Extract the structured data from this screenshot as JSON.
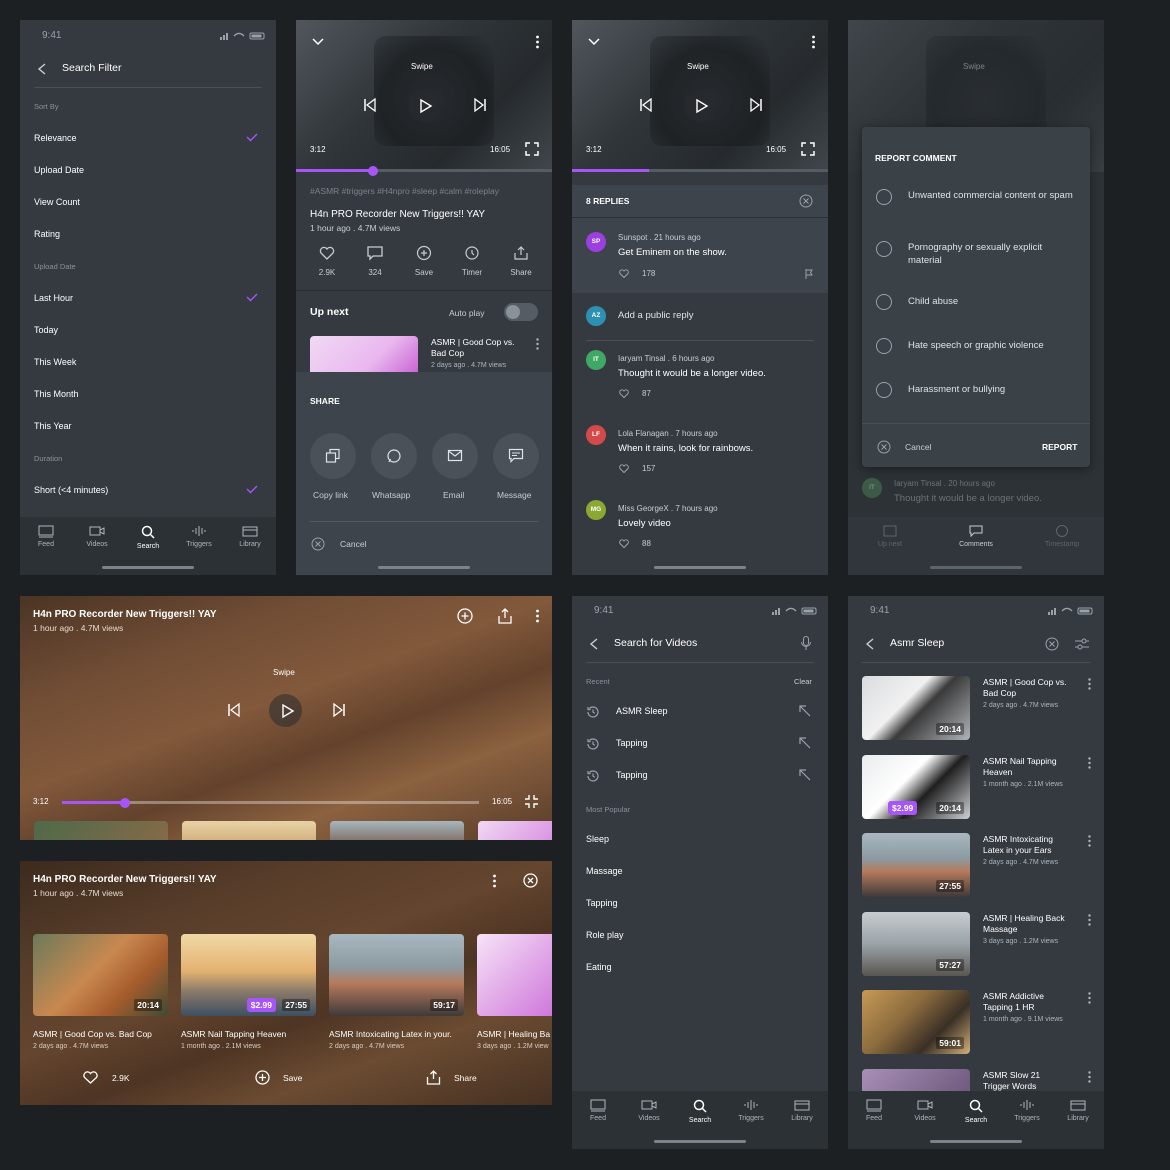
{
  "status_time": "9:41",
  "filter": {
    "title": "Search Filter",
    "sort_by": "Sort By",
    "sort_items": [
      "Relevance",
      "Upload Date",
      "View Count",
      "Rating"
    ],
    "upload_date": "Upload Date",
    "date_items": [
      "Last Hour",
      "Today",
      "This Week",
      "This Month",
      "This Year"
    ],
    "duration": "Duration",
    "duration_items": [
      "Short (<4 minutes)"
    ]
  },
  "nav": {
    "feed": "Feed",
    "videos": "Videos",
    "search": "Search",
    "triggers": "Triggers",
    "library": "Library"
  },
  "player": {
    "swipe": "Swipe",
    "elapsed": "3:12",
    "total": "16:05",
    "progress": 0.3,
    "tags": "#ASMR #triggers #H4npro #sleep #calm #roleplay",
    "title": "H4n PRO Recorder New Triggers!! YAY",
    "meta": "1 hour ago . 4.7M views",
    "likes": "2.9K",
    "comments": "324",
    "save": "Save",
    "timer": "Timer",
    "share": "Share",
    "up_next": "Up next",
    "autoplay": "Auto play",
    "next_title_1": "ASMR | Good Cop vs.",
    "next_title_2": "Bad Cop",
    "next_meta": "2 days ago . 4.7M views"
  },
  "share_sheet": {
    "heading": "SHARE",
    "options": [
      "Copy link",
      "Whatsapp",
      "Email",
      "Message"
    ],
    "cancel": "Cancel"
  },
  "replies": {
    "heading": "8 REPLIES",
    "top": {
      "initials": "SP",
      "meta": "Sunspot . 21 hours ago",
      "text": "Get Eminem on the show.",
      "likes": "178"
    },
    "add_reply": {
      "initials": "AZ",
      "placeholder": "Add a public reply"
    },
    "items": [
      {
        "initials": "IT",
        "meta": "Iaryam Tinsal . 6 hours ago",
        "text": "Thought it would be a longer video.",
        "likes": "87",
        "color": "#3fa865"
      },
      {
        "initials": "LF",
        "meta": "Lola Flanagan . 7 hours ago",
        "text": "When it rains, look for rainbows.",
        "likes": "157",
        "color": "#d34a4a"
      },
      {
        "initials": "MG",
        "meta": "Miss GeorgeX . 7 hours ago",
        "text": "Lovely video",
        "likes": "88",
        "color": "#8aa832"
      }
    ]
  },
  "report": {
    "heading": "REPORT COMMENT",
    "options": [
      "Unwanted commercial content or spam",
      "Pornography or sexually explicit material",
      "Child abuse",
      "Hate speech or graphic violence",
      "Harassment or bullying"
    ],
    "cancel": "Cancel",
    "submit": "REPORT",
    "bg_meta": "Iaryam Tinsal . 20 hours ago",
    "bg_text": "Thought it would be a longer video.",
    "bg_initials": "IT",
    "tabs": [
      "Up next",
      "Comments",
      "Timestamp"
    ]
  },
  "landscape": {
    "title": "H4n PRO Recorder New Triggers!! YAY",
    "meta": "1 hour ago . 4.7M views",
    "swipe": "Swipe",
    "elapsed": "3:12",
    "total": "16:05",
    "progress": 0.15
  },
  "landscape_list": {
    "title": "H4n PRO Recorder New Triggers!! YAY",
    "meta": "1 hour ago . 4.7M views",
    "cards": [
      {
        "title": "ASMR | Good Cop vs. Bad Cop",
        "meta": "2 days ago . 4.7M views",
        "duration": "20:14",
        "price": ""
      },
      {
        "title": "ASMR Nail Tapping Heaven",
        "meta": "1 month ago . 2.1M views",
        "duration": "27:55",
        "price": "$2.99"
      },
      {
        "title": "ASMR Intoxicating Latex in your.",
        "meta": "2 days ago . 4.7M views",
        "duration": "59:17",
        "price": ""
      },
      {
        "title": "ASMR | Healing Ba",
        "meta": "3 days ago . 1.2M view",
        "duration": "",
        "price": ""
      }
    ],
    "likes": "2.9K",
    "save": "Save",
    "share": "Share"
  },
  "search": {
    "placeholder": "Search for Videos",
    "recent": "Recent",
    "clear": "Clear",
    "recent_items": [
      "ASMR Sleep",
      "Tapping",
      "Tapping"
    ],
    "popular": "Most Popular",
    "popular_items": [
      "Sleep",
      "Massage",
      "Tapping",
      "Role play",
      "Eating"
    ]
  },
  "results": {
    "query": "Asmr Sleep",
    "items": [
      {
        "t1": "ASMR | Good Cop vs.",
        "t2": "Bad Cop",
        "meta": "2 days ago . 4.7M views",
        "duration": "20:14",
        "price": ""
      },
      {
        "t1": "ASMR Nail Tapping",
        "t2": "Heaven",
        "meta": "1 month ago . 2.1M views",
        "duration": "20:14",
        "price": "$2.99"
      },
      {
        "t1": "ASMR Intoxicating",
        "t2": "Latex in your Ears",
        "meta": "2 days ago . 4.7M views",
        "duration": "27:55",
        "price": ""
      },
      {
        "t1": "ASMR | Healing Back",
        "t2": "Massage",
        "meta": "3 days ago . 1.2M views",
        "duration": "57:27",
        "price": ""
      },
      {
        "t1": "ASMR Addictive",
        "t2": "Tapping 1 HR",
        "meta": "1 month ago . 9.1M views",
        "duration": "59:01",
        "price": ""
      },
      {
        "t1": "ASMR Slow 21",
        "t2": "Trigger Words",
        "meta": "",
        "duration": "",
        "price": ""
      }
    ]
  },
  "colors": {
    "accent": "#a855f7",
    "background": "#1c2023",
    "panel": "#343a40"
  }
}
